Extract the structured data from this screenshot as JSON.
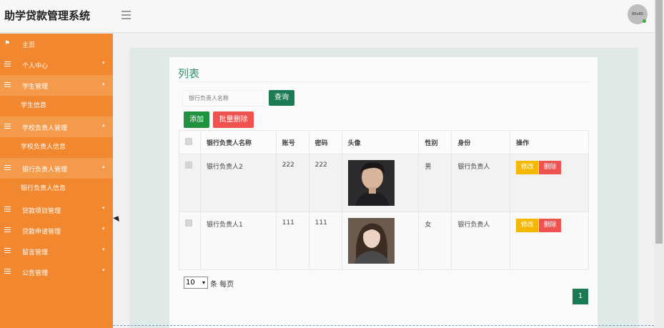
{
  "app": {
    "title": "助学贷款管理系统",
    "avatar_text": "80x80"
  },
  "sidebar": {
    "items": [
      {
        "label": "主页",
        "icon": "flag-icon",
        "arrow": ""
      },
      {
        "label": "个人中心",
        "icon": "list-icon",
        "arrow": "▾"
      },
      {
        "label": "学生管理",
        "icon": "list-icon",
        "arrow": "▴",
        "open": true,
        "sub": [
          "学生信息"
        ]
      },
      {
        "label": "学校负责人管理",
        "icon": "list-icon",
        "arrow": "▴",
        "open": true,
        "sub": [
          "学校负责人信息"
        ]
      },
      {
        "label": "银行负责人管理",
        "icon": "list-icon",
        "arrow": "▴",
        "open": true,
        "sub": [
          "银行负责人信息"
        ]
      },
      {
        "label": "贷款项目管理",
        "icon": "list-icon",
        "arrow": "▾"
      },
      {
        "label": "贷款申请管理",
        "icon": "list-icon",
        "arrow": "▾"
      },
      {
        "label": "留言管理",
        "icon": "list-icon",
        "arrow": "▾"
      },
      {
        "label": "公告管理",
        "icon": "list-icon",
        "arrow": "▾"
      }
    ]
  },
  "main": {
    "title": "列表",
    "search": {
      "placeholder": "银行负责人名称",
      "button": "查询"
    },
    "add_button": "添加",
    "batch_delete_button": "批量删除",
    "table": {
      "headers": [
        "银行负责人名称",
        "账号",
        "密码",
        "头像",
        "性别",
        "身份",
        "操作"
      ],
      "rows": [
        {
          "name": "银行负责人2",
          "account": "222",
          "password": "222",
          "avatar": "photo-male",
          "gender": "男",
          "role": "银行负责人"
        },
        {
          "name": "银行负责人1",
          "account": "111",
          "password": "111",
          "avatar": "photo-female",
          "gender": "女",
          "role": "银行负责人"
        }
      ],
      "edit_label": "修改",
      "delete_label": "删除"
    },
    "pagination": {
      "page_size": "10",
      "page_size_label": "条 每页",
      "current_page": "1"
    }
  },
  "colors": {
    "sidebar": "#f1872e",
    "accent": "#1b7a54",
    "danger": "#ef5350",
    "warning": "#f5b800",
    "add": "#20913f"
  }
}
